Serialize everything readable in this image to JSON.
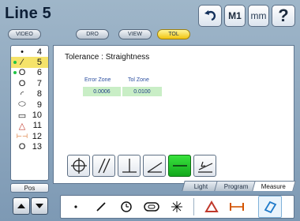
{
  "header": {
    "title": "Line 5",
    "m1_label": "M1",
    "units_label": "mm",
    "help_label": "?"
  },
  "modes": {
    "video": "VIDEO",
    "dro": "DRO",
    "view": "VIEW",
    "tol": "TOL",
    "active": "TOL"
  },
  "feature_list": {
    "items": [
      {
        "symbol": "•",
        "number": "4",
        "dot": false,
        "selected": false
      },
      {
        "symbol": "⁄",
        "number": "5",
        "dot": true,
        "selected": true
      },
      {
        "symbol": "O",
        "number": "6",
        "dot": true,
        "selected": false
      },
      {
        "symbol": "O",
        "number": "7",
        "dot": false,
        "selected": false
      },
      {
        "symbol": "◜",
        "number": "8",
        "dot": false,
        "selected": false
      },
      {
        "symbol": "⬭",
        "number": "9",
        "dot": false,
        "selected": false
      },
      {
        "symbol": "▭",
        "number": "10",
        "dot": false,
        "selected": false
      },
      {
        "symbol": "△",
        "number": "11",
        "dot": false,
        "selected": false
      },
      {
        "symbol": "⊢⊣",
        "number": "12",
        "dot": false,
        "selected": false
      },
      {
        "symbol": "O",
        "number": "13",
        "dot": false,
        "selected": false
      }
    ],
    "pos_label": "Pos"
  },
  "panel": {
    "title": "Tolerance : Straightness",
    "error_zone_label": "Error Zone",
    "tol_zone_label": "Tol Zone",
    "error_zone_value": "0.0006",
    "tol_zone_value": "0.0100"
  },
  "tol_buttons": [
    "position-icon",
    "parallelism-icon",
    "perpendicularity-icon",
    "angularity-icon",
    "straightness-icon",
    "runout-icon"
  ],
  "bottom_tabs": {
    "light": "Light",
    "program": "Program",
    "measure": "Measure",
    "active": "Measure"
  },
  "toolbar": [
    "point-icon",
    "line-icon",
    "circle-icon",
    "slot-icon",
    "pattern-icon",
    "triangle-icon",
    "distance-icon",
    "rectangle-icon"
  ],
  "colors": {
    "selected_row": "#f5e36a",
    "active_button": "#13a91d",
    "active_mode": "#f1c40f",
    "value_bg": "#c9eec6"
  }
}
